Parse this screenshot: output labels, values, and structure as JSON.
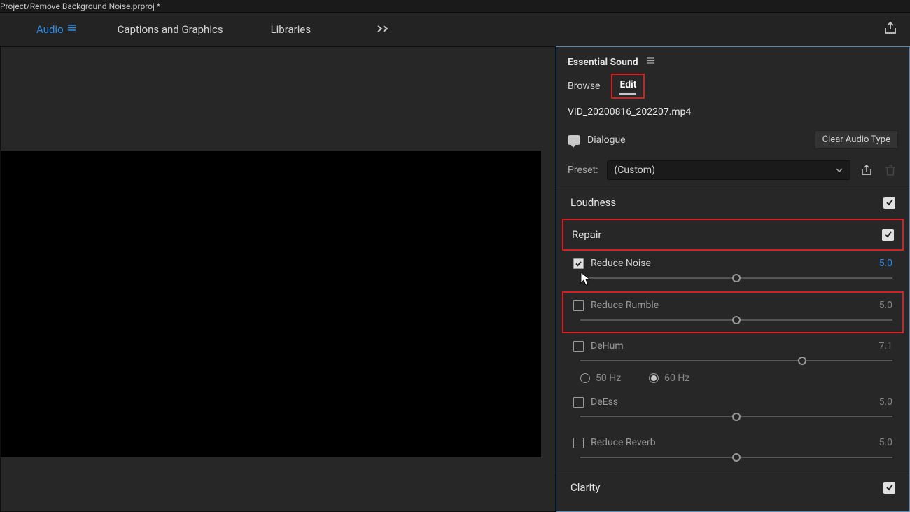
{
  "title": "Project/Remove Background Noise.prproj *",
  "menu": {
    "audio": "Audio",
    "captions": "Captions and Graphics",
    "libraries": "Libraries"
  },
  "panel": {
    "title": "Essential Sound",
    "tabs": {
      "browse": "Browse",
      "edit": "Edit"
    },
    "filename": "VID_20200816_202207.mp4",
    "audioType": "Dialogue",
    "clearBtn": "Clear Audio Type",
    "presetLabel": "Preset:",
    "presetValue": "(Custom)"
  },
  "sections": {
    "loudness": "Loudness",
    "repair": "Repair",
    "clarity": "Clarity"
  },
  "repair": {
    "reduceNoise": {
      "label": "Reduce Noise",
      "value": "5.0",
      "checked": true,
      "pos": 50
    },
    "reduceRumble": {
      "label": "Reduce Rumble",
      "value": "5.0",
      "checked": false,
      "pos": 50
    },
    "deHum": {
      "label": "DeHum",
      "value": "7.1",
      "checked": false,
      "pos": 71
    },
    "hz50": "50 Hz",
    "hz60": "60 Hz",
    "deEss": {
      "label": "DeEss",
      "value": "5.0",
      "checked": false,
      "pos": 50
    },
    "reduceReverb": {
      "label": "Reduce Reverb",
      "value": "5.0",
      "checked": false,
      "pos": 50
    }
  }
}
